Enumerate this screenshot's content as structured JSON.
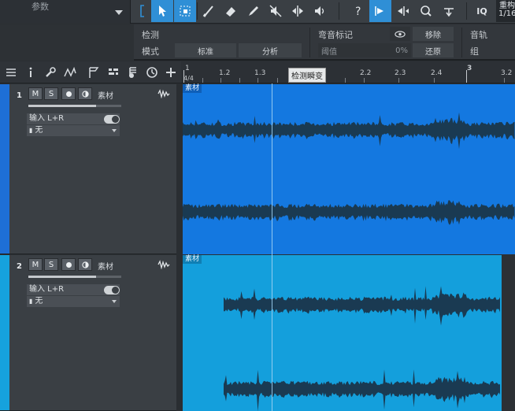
{
  "toolbar": {
    "param_label": "参数",
    "iq_label": "IQ",
    "topright_a": "重构",
    "topright_b": "1/16"
  },
  "inspector": {
    "detect_label": "检测",
    "mode_label": "模式",
    "mode_value": "标准",
    "analyze_button": "分析",
    "bend_marker_label": "弯音标记",
    "remove_button": "移除",
    "threshold_label": "阈值",
    "threshold_value": "0%",
    "restore_button": "还原",
    "track_label": "音轨",
    "group_label": "组"
  },
  "ruler": {
    "ticks": [
      "1",
      "1.2",
      "1.3",
      "2.2",
      "2.3",
      "2.4",
      "3",
      "3.2"
    ],
    "time_signature": "4/4",
    "tooltip": "检测瞬变"
  },
  "tracks": [
    {
      "number": "1",
      "name": "素材",
      "mute": "M",
      "solo": "S",
      "input": "输入 L+R",
      "output": "无",
      "clip_title": "素材",
      "color": "#1e6fd6",
      "clip_color": "#1478e0"
    },
    {
      "number": "2",
      "name": "素材",
      "mute": "M",
      "solo": "S",
      "input": "输入 L+R",
      "output": "无",
      "clip_title": "素材",
      "color": "#16a2dd",
      "clip_color": "#149fdc"
    }
  ],
  "colors": {
    "accent": "#2f8fd6",
    "waveform": "#1a3a52"
  }
}
